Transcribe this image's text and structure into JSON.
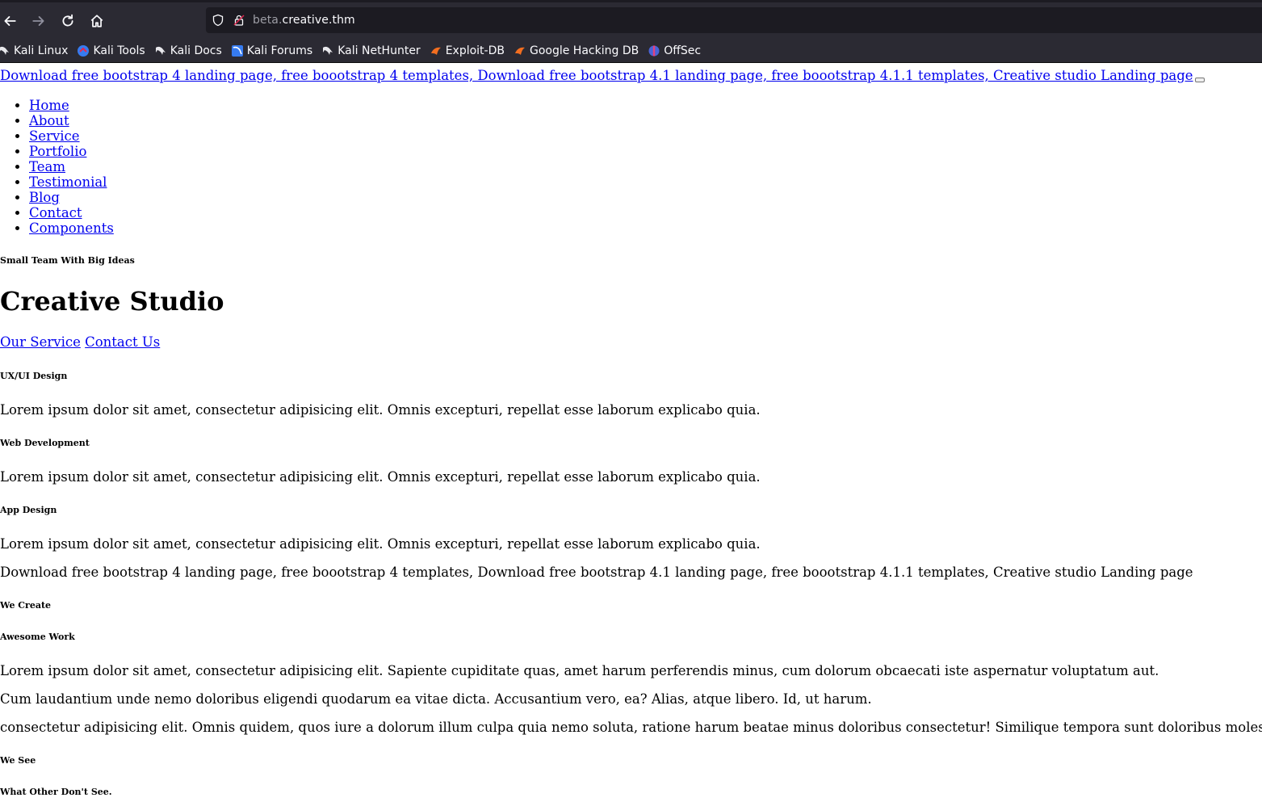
{
  "browser": {
    "url_subdomain": "beta.",
    "url_domain": "creative.thm",
    "bookmarks": [
      {
        "label": "Kali Linux",
        "icon": "kali-dragon-icon"
      },
      {
        "label": "Kali Tools",
        "icon": "kali-tools-icon"
      },
      {
        "label": "Kali Docs",
        "icon": "kali-dragon-icon"
      },
      {
        "label": "Kali Forums",
        "icon": "kali-forums-icon"
      },
      {
        "label": "Kali NetHunter",
        "icon": "kali-dragon-icon"
      },
      {
        "label": "Exploit-DB",
        "icon": "exploit-db-icon"
      },
      {
        "label": "Google Hacking DB",
        "icon": "exploit-db-icon"
      },
      {
        "label": "OffSec",
        "icon": "offsec-icon"
      }
    ]
  },
  "page": {
    "brand_link": "Download free bootstrap 4 landing page, free boootstrap 4 templates, Download free bootstrap 4.1 landing page, free boootstrap 4.1.1 templates, Creative studio Landing page",
    "nav": [
      "Home",
      "About",
      "Service",
      "Portfolio",
      "Team",
      "Testimonial",
      "Blog",
      "Contact",
      "Components"
    ],
    "hero": {
      "subtitle": "Small Team With Big Ideas",
      "title": "Creative Studio",
      "btn_service": "Our Service",
      "btn_contact": "Contact Us"
    },
    "services": [
      {
        "title": "UX/UI Design",
        "text": "Lorem ipsum dolor sit amet, consectetur adipisicing elit. Omnis excepturi, repellat esse laborum explicabo quia."
      },
      {
        "title": "Web Development",
        "text": "Lorem ipsum dolor sit amet, consectetur adipisicing elit. Omnis excepturi, repellat esse laborum explicabo quia."
      },
      {
        "title": "App Design",
        "text": "Lorem ipsum dolor sit amet, consectetur adipisicing elit. Omnis excepturi, repellat esse laborum explicabo quia."
      }
    ],
    "image_alt": "Download free bootstrap 4 landing page, free boootstrap 4 templates, Download free bootstrap 4.1 landing page, free boootstrap 4.1.1 templates, Creative studio Landing page",
    "about": {
      "subtitle": "We Create",
      "title": "Awesome Work",
      "p1": "Lorem ipsum dolor sit amet, consectetur adipisicing elit. Sapiente cupiditate quas, amet harum perferendis minus, cum dolorum obcaecati iste aspernatur voluptatum aut.",
      "p2": "Cum laudantium unde nemo doloribus eligendi quodarum ea vitae dicta. Accusantium vero, ea? Alias, atque libero. Id, ut harum.",
      "p3": "consectetur adipisicing elit. Omnis quidem, quos iure a dolorum illum culpa quia nemo soluta, ratione harum beatae minus doloribus consectetur! Similique tempora sunt doloribus molestias."
    },
    "see": {
      "subtitle": "We See",
      "title": "What Other Don't See."
    }
  }
}
